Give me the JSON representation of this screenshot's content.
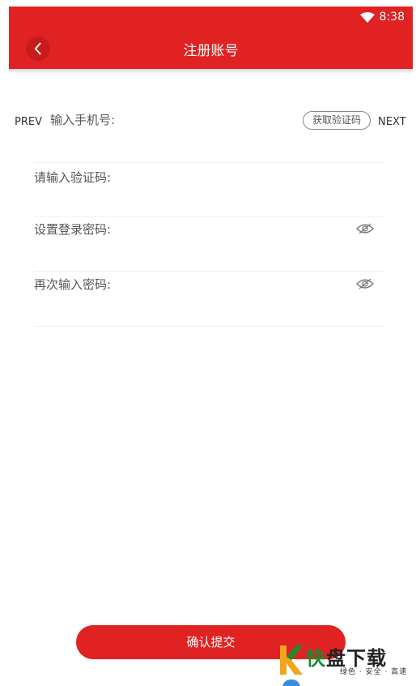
{
  "status_bar": {
    "time": "8:38"
  },
  "header": {
    "title": "注册账号"
  },
  "nav": {
    "prev_label": "PREV",
    "next_label": "NEXT"
  },
  "form": {
    "phone_label": "输入手机号:",
    "get_code_label": "获取验证码",
    "code_label": "请输入验证码:",
    "password_label": "设置登录密码:",
    "confirm_password_label": "再次输入密码:"
  },
  "submit": {
    "label": "确认提交"
  },
  "watermark": {
    "title_green": "快",
    "title_dark": "盘下载",
    "subtitle": "绿色 · 安全 · 高速"
  },
  "colors": {
    "brand": "#e02222",
    "watermark_green": "#1d8a2f"
  }
}
